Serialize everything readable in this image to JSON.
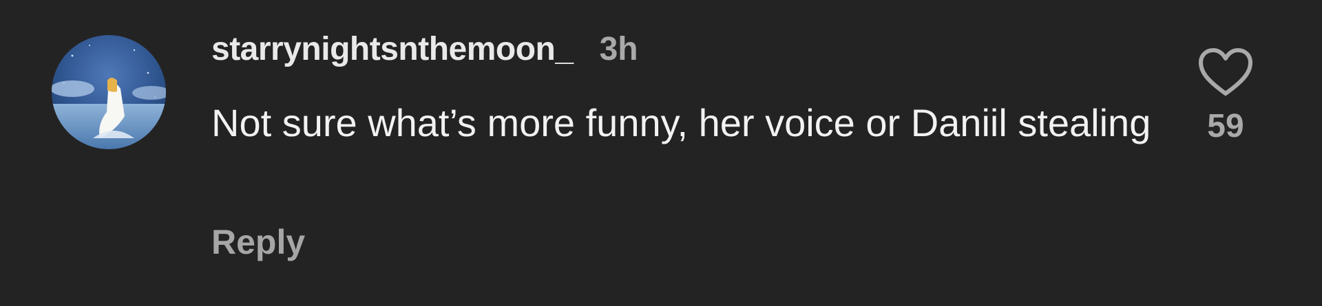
{
  "comment": {
    "avatar_icon": "user-avatar-moon-illustration",
    "username": "starrynightsnthemoon_",
    "time": "3h",
    "text": "Not sure what’s more funny, her voice or Daniil stealing",
    "reply_label": "Reply",
    "like_icon": "heart-outline-icon",
    "like_count": "59"
  },
  "colors": {
    "background": "#232323",
    "username": "#e9e9e9",
    "text": "#f2f2f2",
    "muted": "#a9a9a9"
  }
}
